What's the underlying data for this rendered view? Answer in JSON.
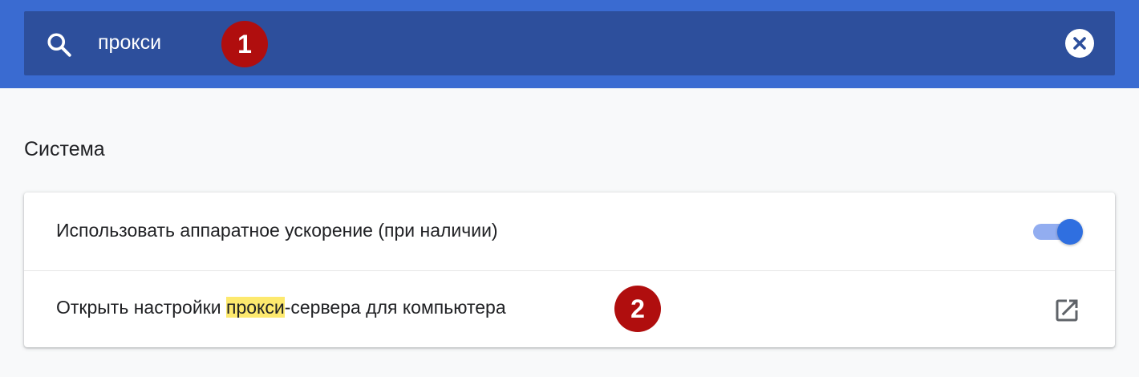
{
  "search": {
    "value": "прокси",
    "icon": "search-icon",
    "clear_icon": "close-icon"
  },
  "annotations": {
    "badge_1": "1",
    "badge_2": "2"
  },
  "section": {
    "title": "Система"
  },
  "settings": {
    "hardware_acceleration": {
      "label": "Использовать аппаратное ускорение (при наличии)",
      "enabled": true
    },
    "proxy": {
      "label_before": "Открыть настройки ",
      "label_highlight": "прокси",
      "label_after": "-сервера для компьютера",
      "icon": "open-in-new-icon"
    }
  },
  "colors": {
    "header": "#3a6bd1",
    "searchbox": "#2d4f9c",
    "toggle_on": "#2f6fe0",
    "highlight": "#fde96e",
    "badge": "#b00e0e"
  }
}
